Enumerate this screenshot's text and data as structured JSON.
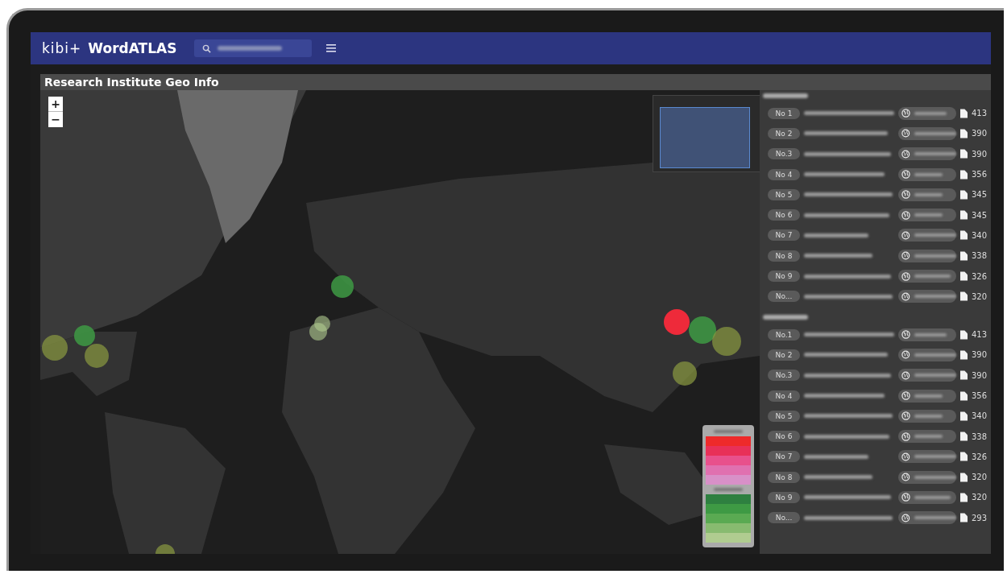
{
  "header": {
    "logo": "kibi+",
    "app_name": "WordATLAS"
  },
  "panel": {
    "title": "Research Institute Geo Info"
  },
  "map": {
    "kind": "picture",
    "zoom_in": "+",
    "zoom_out": "−",
    "legend": [
      {
        "swatches": [
          {
            "color": "#ee2a2a"
          },
          {
            "color": "#e83058"
          },
          {
            "color": "#e8508c"
          },
          {
            "color": "#e070b0"
          },
          {
            "color": "#d890c8"
          }
        ]
      },
      {
        "swatches": [
          {
            "color": "#2e8040"
          },
          {
            "color": "#3e9a44"
          },
          {
            "color": "#5aaa52"
          },
          {
            "color": "#88bb70"
          },
          {
            "color": "#b0cc90"
          }
        ]
      }
    ]
  },
  "lists": [
    {
      "rows": [
        {
          "rank": "No 1",
          "count": "413"
        },
        {
          "rank": "No 2",
          "count": "390"
        },
        {
          "rank": "No.3",
          "count": "390"
        },
        {
          "rank": "No 4",
          "count": "356"
        },
        {
          "rank": "No 5",
          "count": "345"
        },
        {
          "rank": "No 6",
          "count": "345"
        },
        {
          "rank": "No 7",
          "count": "340"
        },
        {
          "rank": "No 8",
          "count": "338"
        },
        {
          "rank": "No 9",
          "count": "326"
        },
        {
          "rank": "No...",
          "count": "320"
        }
      ]
    },
    {
      "rows": [
        {
          "rank": "No.1",
          "count": "413"
        },
        {
          "rank": "No 2",
          "count": "390"
        },
        {
          "rank": "No.3",
          "count": "390"
        },
        {
          "rank": "No 4",
          "count": "356"
        },
        {
          "rank": "No 5",
          "count": "340"
        },
        {
          "rank": "No 6",
          "count": "338"
        },
        {
          "rank": "No 7",
          "count": "326"
        },
        {
          "rank": "No 8",
          "count": "320"
        },
        {
          "rank": "No 9",
          "count": "320"
        },
        {
          "rank": "No...",
          "count": "293"
        }
      ]
    }
  ]
}
